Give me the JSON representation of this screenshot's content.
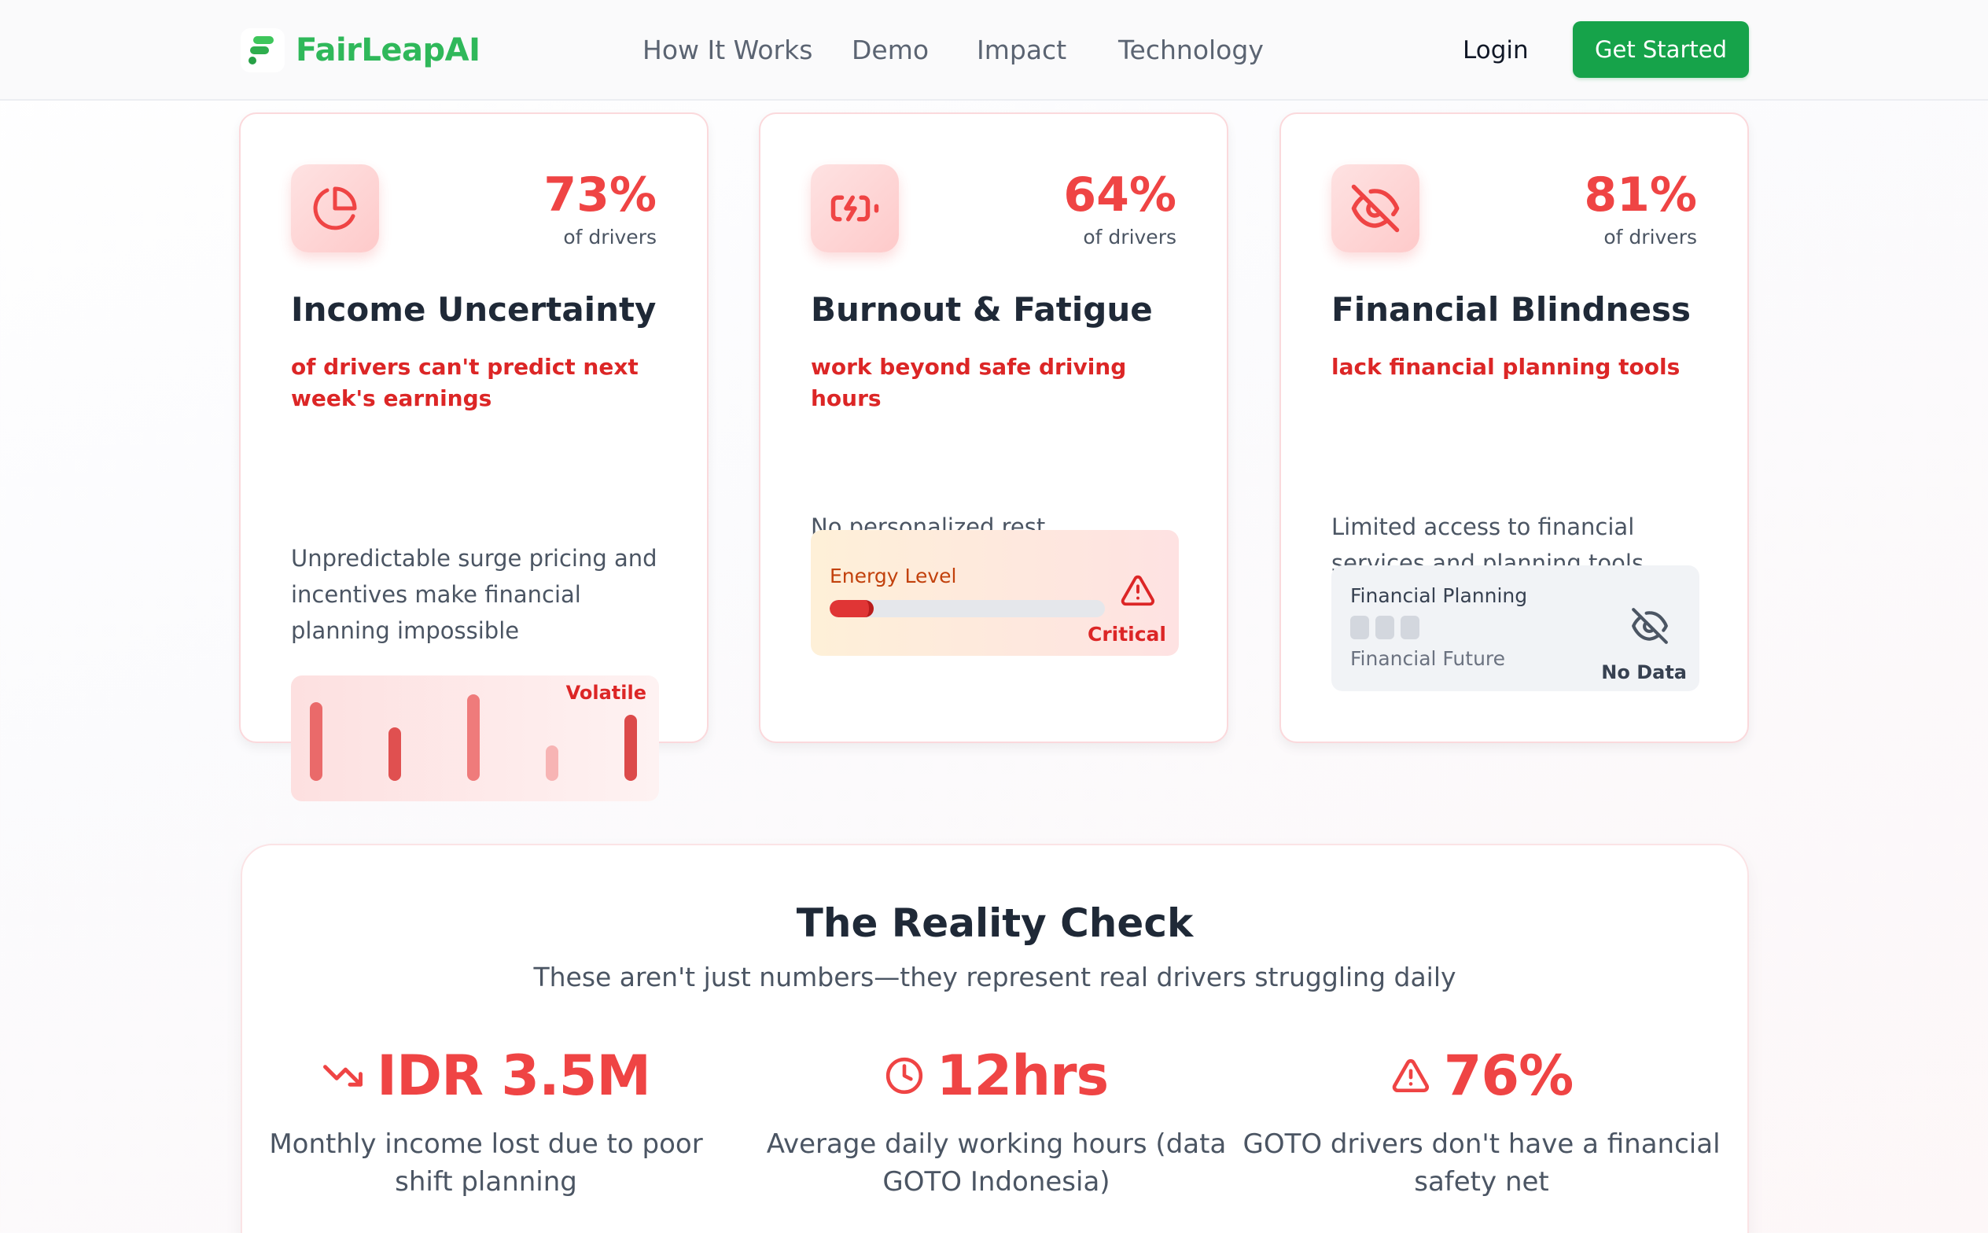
{
  "header": {
    "brand": "FairLeapAI",
    "nav": [
      "How It Works",
      "Demo",
      "Impact",
      "Technology"
    ],
    "login": "Login",
    "cta": "Get Started"
  },
  "cards": [
    {
      "icon": "pie-chart-icon",
      "stat": "73%",
      "stat_sub": "of drivers",
      "title": "Income Uncertainty",
      "highlight": "of drivers can't predict next week's earnings",
      "description": "Unpredictable surge pricing and incentives make financial planning impossible",
      "widget_label": "Volatile",
      "volatility": [
        0.62,
        0.42,
        0.68,
        0.28,
        0.52
      ]
    },
    {
      "icon": "battery-charging-icon",
      "stat": "64%",
      "stat_sub": "of drivers",
      "title": "Burnout & Fatigue",
      "highlight": "work beyond safe driving hours",
      "description": "No personalized rest recommendations lead to dangerous exhaustion",
      "widget_label": "Energy Level",
      "widget_status": "Critical",
      "energy_level": 0.2
    },
    {
      "icon": "eye-off-icon",
      "stat": "81%",
      "stat_sub": "of drivers",
      "title": "Financial Blindness",
      "highlight": "lack financial planning tools",
      "description": "Limited access to financial services and planning tools keeps drivers struggling without clear financial visibility.",
      "widget_label": "Financial Planning",
      "widget_sub": "Financial Future",
      "widget_status": "No Data"
    }
  ],
  "reality": {
    "title": "The Reality Check",
    "subtitle": "These aren't just numbers—they represent real drivers struggling daily",
    "stats": [
      {
        "icon": "trending-down-icon",
        "value": "IDR 3.5M",
        "text": "Monthly income lost due to poor shift planning"
      },
      {
        "icon": "clock-icon",
        "value": "12hrs",
        "text": "Average daily working hours (data GOTO Indonesia)"
      },
      {
        "icon": "alert-triangle-icon",
        "value": "76%",
        "text": "GOTO drivers don't have a financial safety net"
      }
    ]
  },
  "colors": {
    "brand": "#2fb85a",
    "cta": "#16a34a",
    "alert": "#ef4444",
    "alert_dark": "#dc2626"
  }
}
